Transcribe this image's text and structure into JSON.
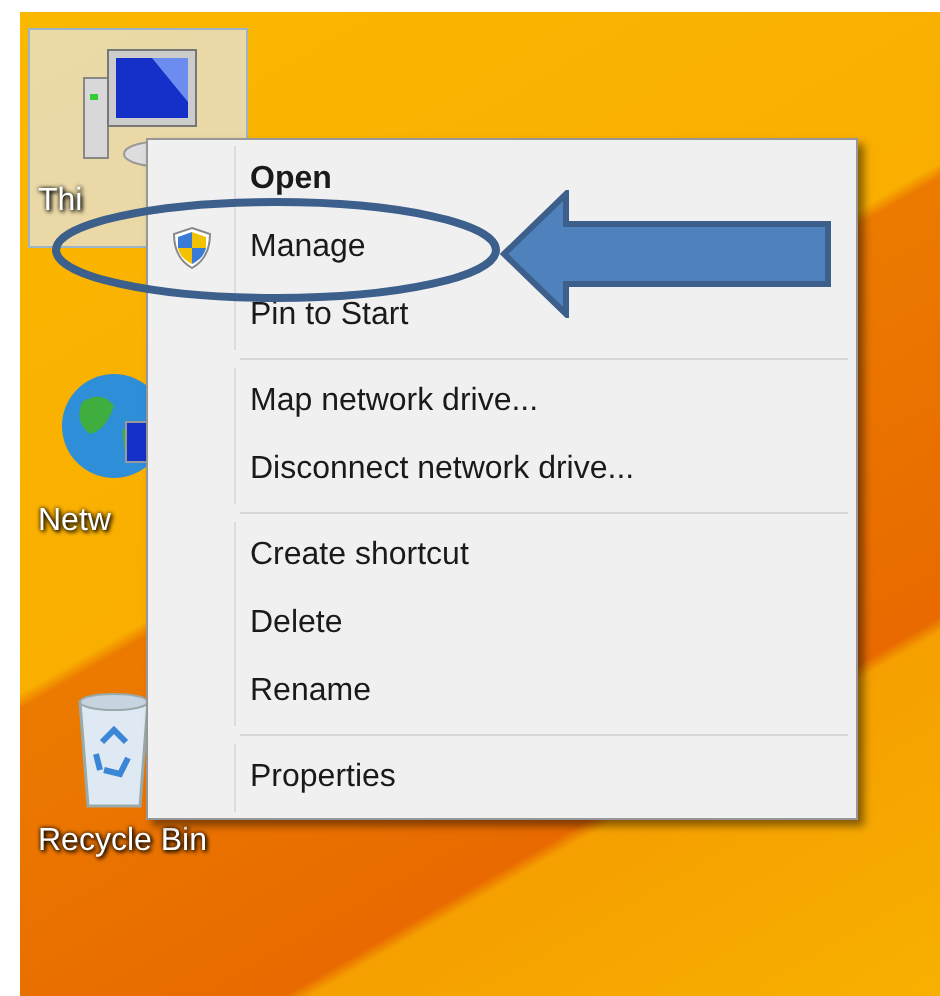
{
  "desktop_icons": [
    {
      "label": "Thi",
      "kind": "computer",
      "selected": true
    },
    {
      "label": "Netw",
      "kind": "network",
      "selected": false
    },
    {
      "label": "Recycle Bin",
      "kind": "recycle",
      "selected": false
    }
  ],
  "context_menu": {
    "items": [
      {
        "kind": "item",
        "label": "Open",
        "default": true,
        "admin_shield": false
      },
      {
        "kind": "item",
        "label": "Manage",
        "default": false,
        "admin_shield": true
      },
      {
        "kind": "item",
        "label": "Pin to Start",
        "default": false,
        "admin_shield": false
      },
      {
        "kind": "separator"
      },
      {
        "kind": "item",
        "label": "Map network drive...",
        "default": false,
        "admin_shield": false
      },
      {
        "kind": "item",
        "label": "Disconnect network drive...",
        "default": false,
        "admin_shield": false
      },
      {
        "kind": "separator"
      },
      {
        "kind": "item",
        "label": "Create shortcut",
        "default": false,
        "admin_shield": false
      },
      {
        "kind": "item",
        "label": "Delete",
        "default": false,
        "admin_shield": false
      },
      {
        "kind": "item",
        "label": "Rename",
        "default": false,
        "admin_shield": false
      },
      {
        "kind": "separator"
      },
      {
        "kind": "item",
        "label": "Properties",
        "default": false,
        "admin_shield": false
      }
    ]
  }
}
